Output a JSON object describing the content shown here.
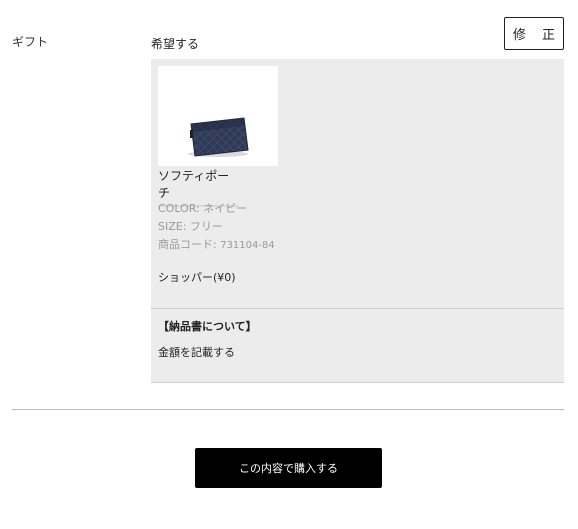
{
  "gift": {
    "label": "ギフト",
    "option": "希望する",
    "edit_label": "修 正"
  },
  "product": {
    "name": "ソフティポーチ",
    "image_icon": "pouch-photo",
    "color_label": "COLOR: ",
    "color_value": "ネイビー",
    "size_label": "SIZE: ",
    "size_value": "フリー",
    "code_label": "商品コード: ",
    "code_value": "731104-84",
    "shopper": "ショッパー(¥0)"
  },
  "invoice": {
    "title": "【納品書について】",
    "value": "金額を記載する"
  },
  "actions": {
    "purchase_label": "この内容で購入する"
  },
  "colors": {
    "panel_bg": "#ececec",
    "button_bg": "#000000",
    "product_navy": "#2b3550"
  }
}
